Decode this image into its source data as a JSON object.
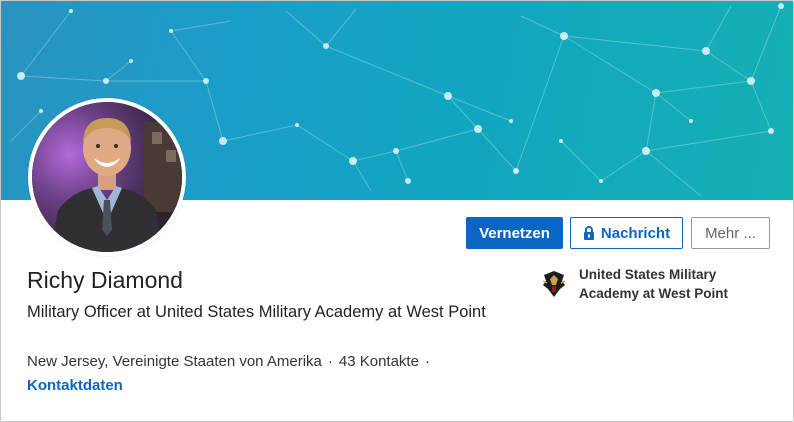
{
  "profile": {
    "name": "Richy Diamond",
    "headline": "Military Officer at United States Military Academy at West Point",
    "location": "New Jersey, Vereinigte Staaten von Amerika",
    "connections": "43 Kontakte",
    "separator": "·",
    "contact_info": "Kontaktdaten"
  },
  "actions": {
    "connect_label": "Vernetzen",
    "message_label": "Nachricht",
    "more_label": "Mehr ..."
  },
  "education": {
    "school": "United States Military Academy at West Point",
    "logo_icon": "west-point-crest-icon"
  },
  "colors": {
    "primary": "#0a66c2",
    "banner_start": "#2a93bf",
    "banner_end": "#16b0b4"
  }
}
